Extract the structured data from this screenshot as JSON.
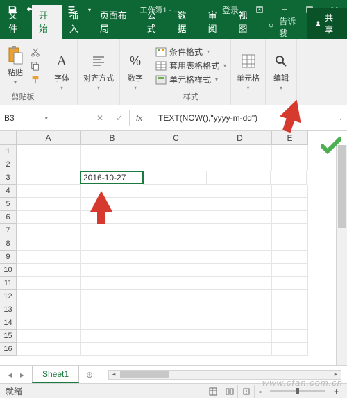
{
  "title": "工作簿1 - ...",
  "login": "登录",
  "tabs": {
    "file": "文件",
    "home": "开始",
    "insert": "插入",
    "layout": "页面布局",
    "formulas": "公式",
    "data": "数据",
    "review": "审阅",
    "view": "视图",
    "tellme": "告诉我",
    "share": "共享"
  },
  "ribbon": {
    "clipboard": {
      "paste": "粘贴",
      "label": "剪贴板"
    },
    "font": {
      "btn": "字体",
      "label": ""
    },
    "align": {
      "btn": "对齐方式",
      "label": ""
    },
    "number": {
      "btn": "数字",
      "label": ""
    },
    "styles": {
      "cond": "条件格式",
      "table": "套用表格格式",
      "cells": "单元格样式",
      "label": "样式"
    },
    "cellsg": {
      "btn": "单元格",
      "label": ""
    },
    "editing": {
      "btn": "编辑",
      "label": ""
    }
  },
  "namebox": "B3",
  "formula": "=TEXT(NOW(),\"yyyy-m-dd\")",
  "fx": "fx",
  "columns": [
    "A",
    "B",
    "C",
    "D",
    "E"
  ],
  "rows": [
    1,
    2,
    3,
    4,
    5,
    6,
    7,
    8,
    9,
    10,
    11,
    12,
    13,
    14,
    15,
    16
  ],
  "cells": {
    "B3": "2016-10-27"
  },
  "sheet": "Sheet1",
  "status": "就绪",
  "zoom_minus": "-",
  "zoom_plus": "+",
  "watermark": "www.cfan.com.cn"
}
